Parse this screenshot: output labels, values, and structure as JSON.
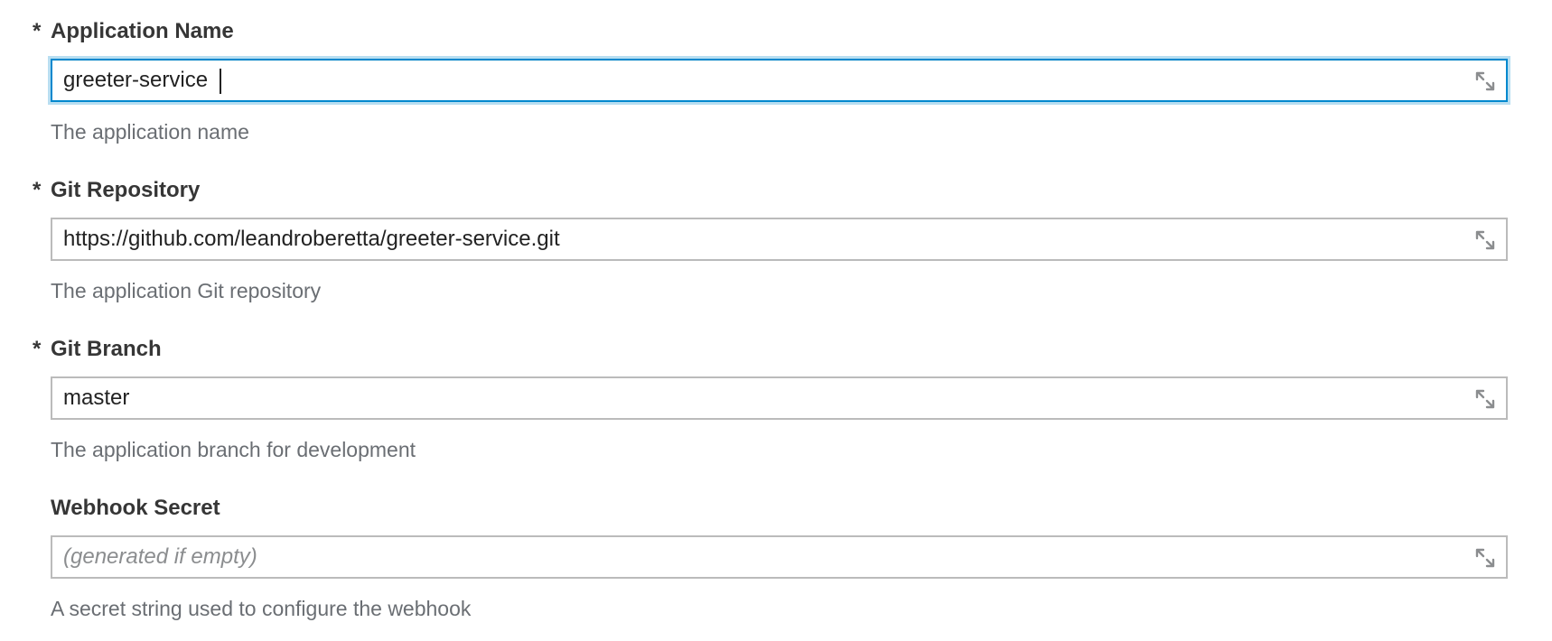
{
  "form": {
    "fields": [
      {
        "required_marker": "*",
        "label": "Application Name",
        "value": "greeter-service",
        "placeholder": "",
        "help": "The application name",
        "focused": true
      },
      {
        "required_marker": "*",
        "label": "Git Repository",
        "value": "https://github.com/leandroberetta/greeter-service.git",
        "placeholder": "",
        "help": "The application Git repository",
        "focused": false
      },
      {
        "required_marker": "*",
        "label": "Git Branch",
        "value": "master",
        "placeholder": "",
        "help": "The application branch for development",
        "focused": false
      },
      {
        "required_marker": "",
        "label": "Webhook Secret",
        "value": "",
        "placeholder": "(generated if empty)",
        "help": "A secret string used to configure the webhook",
        "focused": false
      }
    ]
  },
  "icons": {
    "expand": "expand-icon"
  },
  "colors": {
    "focus_border": "#0088ce",
    "border": "#bbbbbb",
    "help_text": "#6a6e73",
    "label_text": "#363636"
  }
}
